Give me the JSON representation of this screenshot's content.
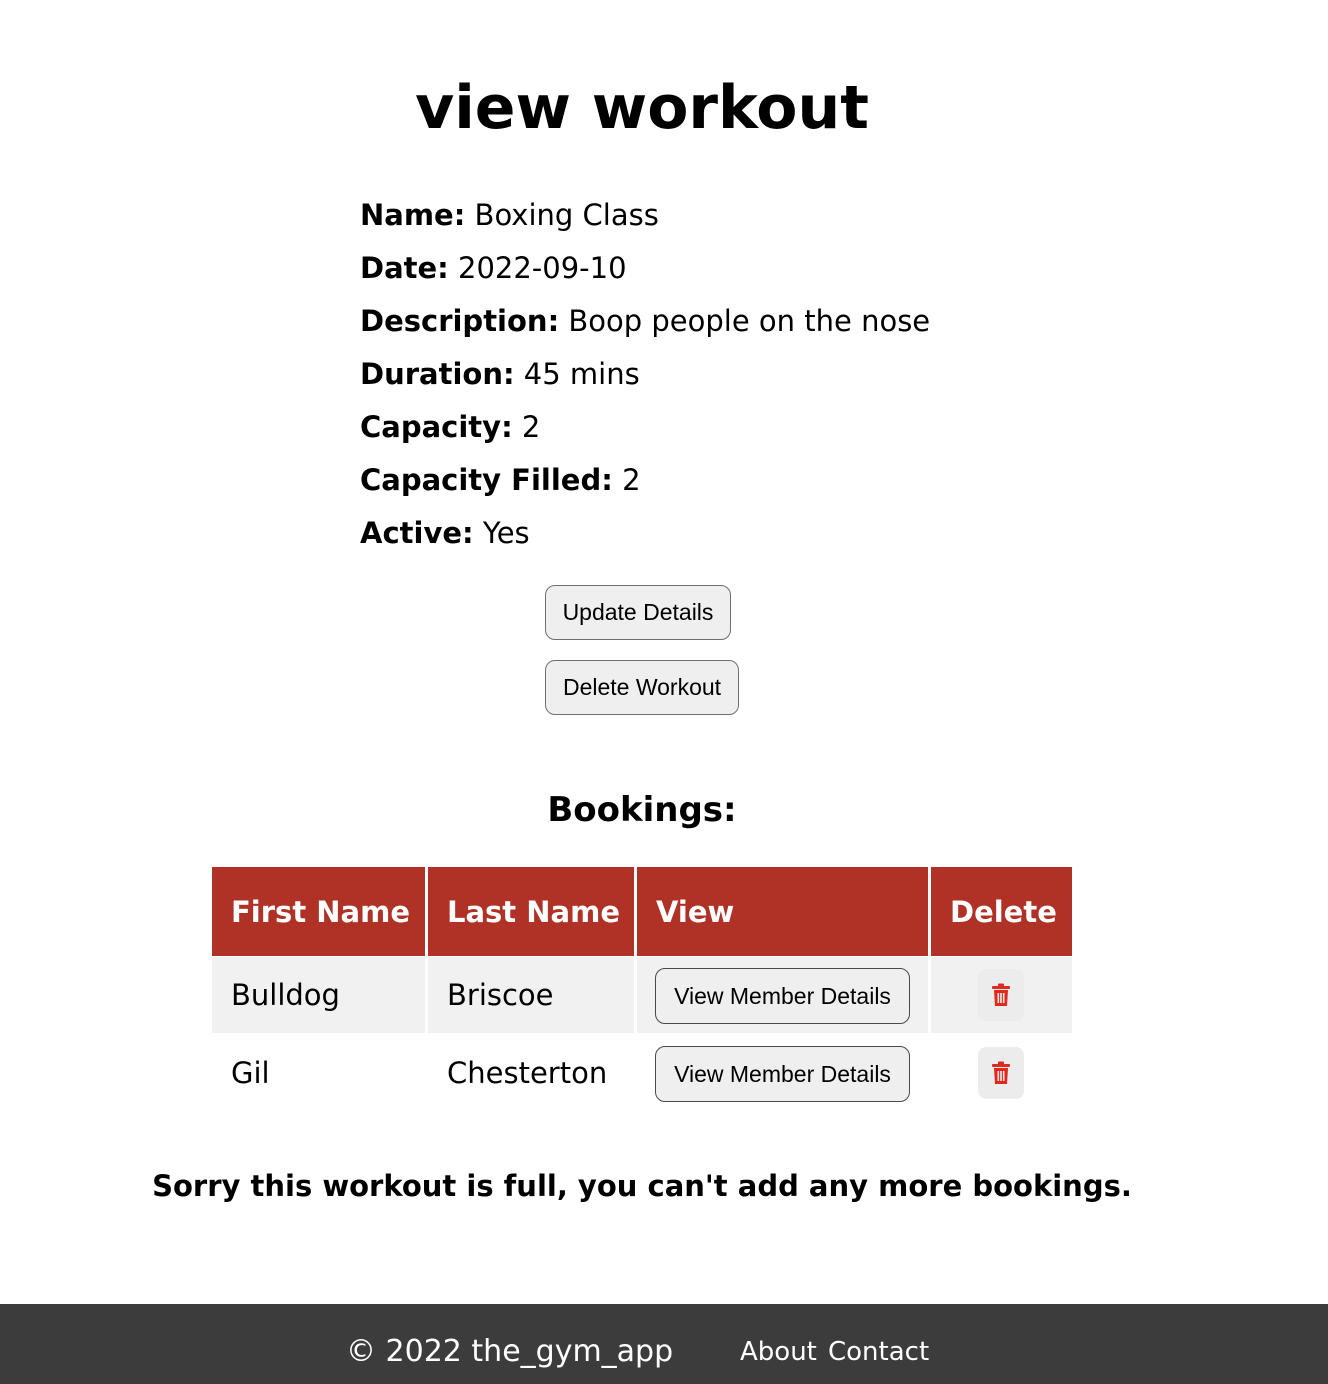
{
  "page": {
    "title": "view workout"
  },
  "workout": {
    "fields": [
      {
        "label": "Name:",
        "value": "Boxing Class"
      },
      {
        "label": "Date:",
        "value": "2022-09-10"
      },
      {
        "label": "Description:",
        "value": "Boop people on the nose"
      },
      {
        "label": "Duration:",
        "value": "45 mins"
      },
      {
        "label": "Capacity:",
        "value": "2"
      },
      {
        "label": "Capacity Filled:",
        "value": "2"
      },
      {
        "label": "Active:",
        "value": "Yes"
      }
    ],
    "update_button": "Update Details",
    "delete_button": "Delete Workout"
  },
  "bookings": {
    "title": "Bookings:",
    "headers": [
      "First Name",
      "Last Name",
      "View",
      "Delete"
    ],
    "rows": [
      {
        "first_name": "Bulldog",
        "last_name": "Briscoe",
        "view_button": "View Member Details",
        "delete_icon": "trash-icon"
      },
      {
        "first_name": "Gil",
        "last_name": "Chesterton",
        "view_button": "View Member Details",
        "delete_icon": "trash-icon"
      }
    ],
    "full_message": "Sorry this workout is full, you can't add any more bookings."
  },
  "footer": {
    "copyright": "© 2022 the_gym_app",
    "links": [
      "About",
      "Contact"
    ]
  },
  "colors": {
    "header_bg": "#b03226",
    "footer_bg": "#3c3c3c",
    "trash_icon": "#e0281c"
  }
}
